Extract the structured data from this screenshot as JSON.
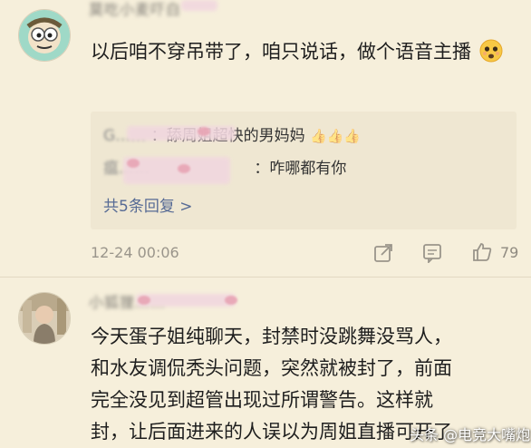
{
  "comment1": {
    "username": "莫吃小麦吓白",
    "text": "以后咱不穿吊带了，咱只说话，做个语音主播",
    "emoji": "frowning-face-emoji",
    "replies": [
      {
        "author": "G……",
        "text": "：舔周姐超快的男妈妈"
      },
      {
        "author": "瘟……",
        "text": "：咋哪都有你"
      }
    ],
    "more_replies": "共5条回复 >",
    "timestamp": "12-24 00:06",
    "like_count": "79"
  },
  "comment2": {
    "username": "小狐狸……",
    "lines": [
      "今天蛋子姐纯聊天，封禁时没跳舞没骂人，",
      "和水友调侃秃头问题，突然就被封了，前面",
      "完全没见到超管出现过所谓警告。这样就",
      "封，让后面进来的人误以为周姐直播可开了"
    ]
  },
  "watermark": "头条 @电竞大嘴炮",
  "colors": {
    "background": "#f6efdb",
    "reply_box": "#efe7d2",
    "link": "#576b95",
    "meta": "#9a958b"
  }
}
